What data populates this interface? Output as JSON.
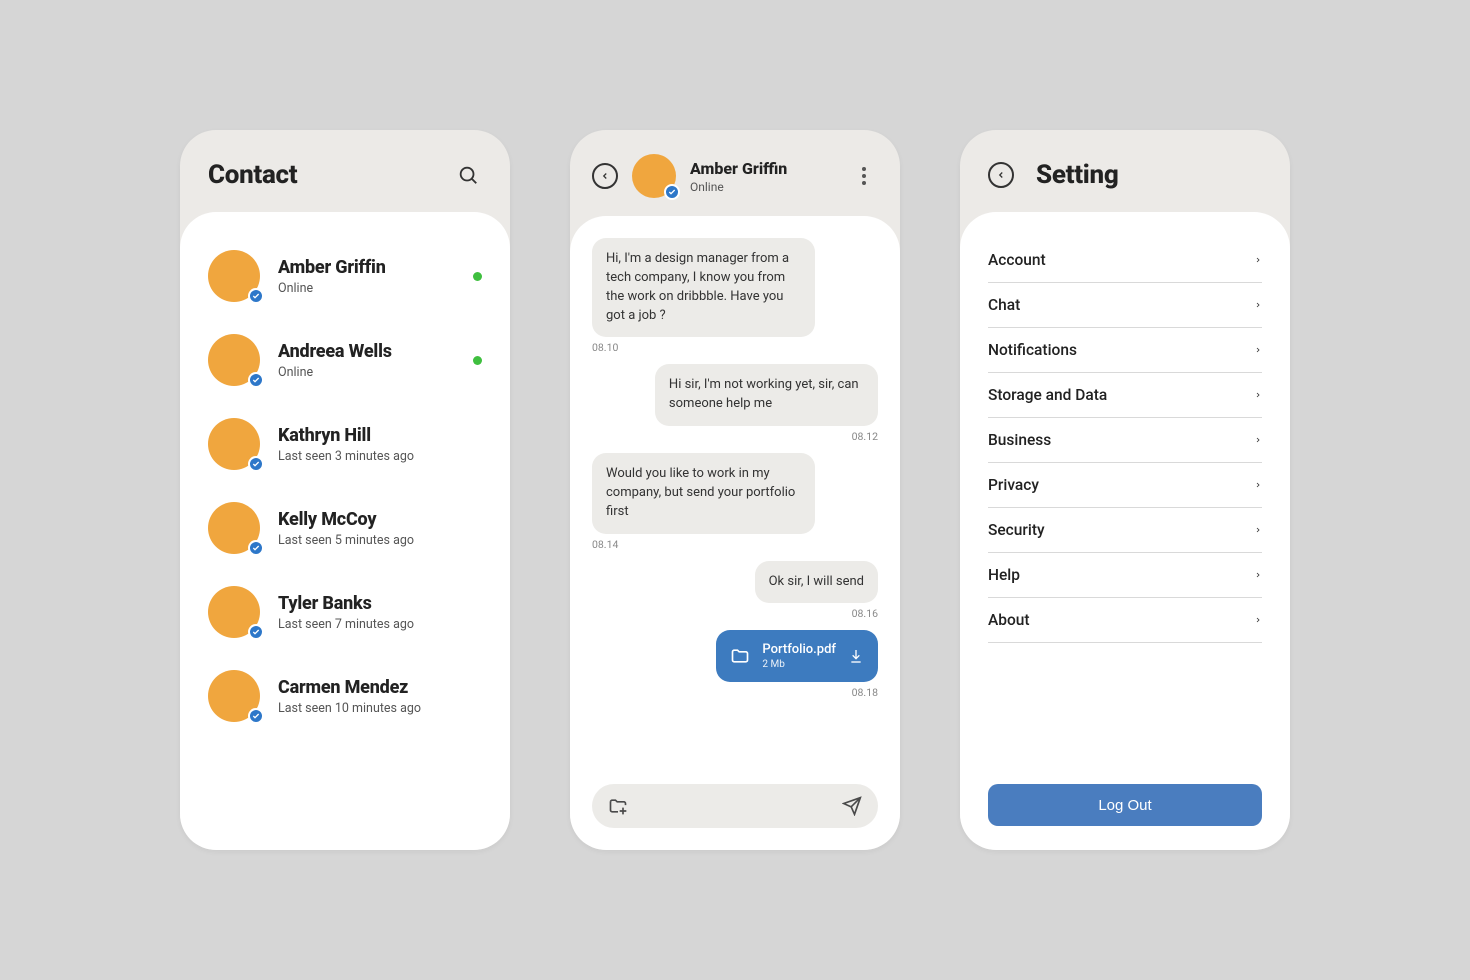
{
  "colors": {
    "accent": "#4a7dbf",
    "avatar": "#f0a63e",
    "online": "#3fbf3f",
    "verified": "#2d77c9"
  },
  "contact_screen": {
    "title": "Contact",
    "items": [
      {
        "name": "Amber Griffin",
        "status": "Online",
        "online": true
      },
      {
        "name": "Andreea Wells",
        "status": "Online",
        "online": true
      },
      {
        "name": "Kathryn Hill",
        "status": "Last seen 3 minutes ago",
        "online": false
      },
      {
        "name": "Kelly McCoy",
        "status": "Last seen 5 minutes ago",
        "online": false
      },
      {
        "name": "Tyler Banks",
        "status": "Last seen 7 minutes ago",
        "online": false
      },
      {
        "name": "Carmen Mendez",
        "status": "Last seen 10 minutes ago",
        "online": false
      }
    ]
  },
  "chat_screen": {
    "header": {
      "name": "Amber Griffin",
      "status": "Online"
    },
    "messages": [
      {
        "side": "left",
        "text": "Hi, I'm a design manager from a tech company, I know you from the work on dribbble. Have you got a job ?",
        "time": "08.10"
      },
      {
        "side": "right",
        "text": "Hi sir, I'm not working yet, sir, can someone help me",
        "time": "08.12"
      },
      {
        "side": "left",
        "text": "Would you like to work in my company, but send your portfolio first",
        "time": "08.14"
      },
      {
        "side": "right",
        "text": "Ok sir, I will send",
        "time": "08.16"
      }
    ],
    "attachment": {
      "filename": "Portfolio.pdf",
      "size": "2 Mb",
      "time": "08.18"
    }
  },
  "settings_screen": {
    "title": "Setting",
    "items": [
      {
        "label": "Account"
      },
      {
        "label": "Chat"
      },
      {
        "label": "Notifications"
      },
      {
        "label": "Storage and Data"
      },
      {
        "label": "Business"
      },
      {
        "label": "Privacy"
      },
      {
        "label": "Security"
      },
      {
        "label": "Help"
      },
      {
        "label": "About"
      }
    ],
    "logout": "Log Out"
  }
}
